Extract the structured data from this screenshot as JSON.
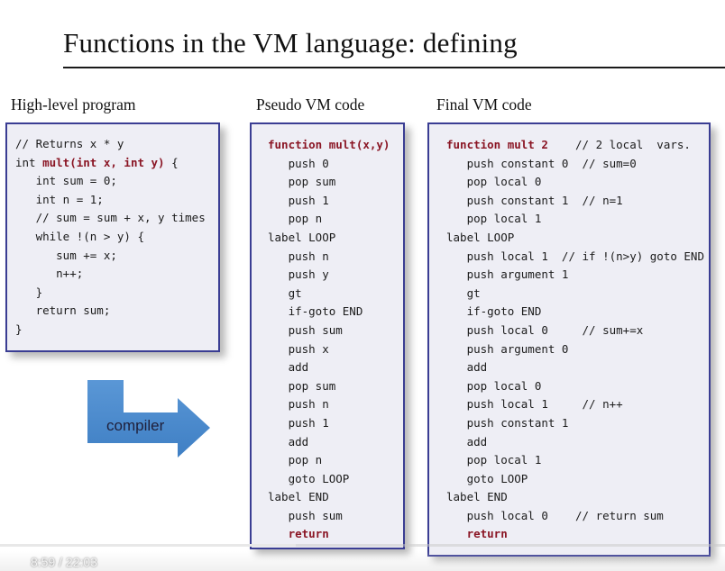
{
  "slide": {
    "title": "Functions in the VM language: defining",
    "columns": {
      "high_level": "High-level program",
      "pseudo": "Pseudo VM code",
      "final": "Final VM code"
    },
    "arrow_label": "compiler",
    "high_level_code": [
      [
        {
          "t": "// Returns x * y"
        }
      ],
      [
        {
          "t": "int "
        },
        {
          "t": "mult(int x, int y)",
          "k": true
        },
        {
          "t": " {"
        }
      ],
      [
        {
          "t": "   int sum = 0;"
        }
      ],
      [
        {
          "t": "   int n = 1;"
        }
      ],
      [
        {
          "t": "   // sum = sum + x, y times"
        }
      ],
      [
        {
          "t": "   while !(n > y) {"
        }
      ],
      [
        {
          "t": "      sum += x;"
        }
      ],
      [
        {
          "t": "      n++;"
        }
      ],
      [
        {
          "t": "   }"
        }
      ],
      [
        {
          "t": "   return sum;"
        }
      ],
      [
        {
          "t": "}"
        }
      ]
    ],
    "pseudo_code": [
      [
        {
          "t": "function mult(x,y)",
          "k": true
        }
      ],
      [
        {
          "t": "   push 0"
        }
      ],
      [
        {
          "t": "   pop sum"
        }
      ],
      [
        {
          "t": "   push 1"
        }
      ],
      [
        {
          "t": "   pop n"
        }
      ],
      [
        {
          "t": "label LOOP"
        }
      ],
      [
        {
          "t": "   push n"
        }
      ],
      [
        {
          "t": "   push y"
        }
      ],
      [
        {
          "t": "   gt"
        }
      ],
      [
        {
          "t": "   if-goto END"
        }
      ],
      [
        {
          "t": "   push sum"
        }
      ],
      [
        {
          "t": "   push x"
        }
      ],
      [
        {
          "t": "   add"
        }
      ],
      [
        {
          "t": "   pop sum"
        }
      ],
      [
        {
          "t": "   push n"
        }
      ],
      [
        {
          "t": "   push 1"
        }
      ],
      [
        {
          "t": "   add"
        }
      ],
      [
        {
          "t": "   pop n"
        }
      ],
      [
        {
          "t": "   goto LOOP"
        }
      ],
      [
        {
          "t": "label END"
        }
      ],
      [
        {
          "t": "   push sum"
        }
      ],
      [
        {
          "t": "   return",
          "k": true
        }
      ]
    ],
    "final_code": [
      [
        {
          "t": "function mult 2",
          "k": true
        },
        {
          "t": "    // 2 local  vars."
        }
      ],
      [
        {
          "t": "   push constant 0  // sum=0"
        }
      ],
      [
        {
          "t": "   pop local 0"
        }
      ],
      [
        {
          "t": "   push constant 1  // n=1"
        }
      ],
      [
        {
          "t": "   pop local 1"
        }
      ],
      [
        {
          "t": "label LOOP"
        }
      ],
      [
        {
          "t": "   push local 1  // if !(n>y) goto END"
        }
      ],
      [
        {
          "t": "   push argument 1"
        }
      ],
      [
        {
          "t": "   gt"
        }
      ],
      [
        {
          "t": "   if-goto END"
        }
      ],
      [
        {
          "t": "   push local 0     // sum+=x"
        }
      ],
      [
        {
          "t": "   push argument 0"
        }
      ],
      [
        {
          "t": "   add"
        }
      ],
      [
        {
          "t": "   pop local 0"
        }
      ],
      [
        {
          "t": "   push local 1     // n++"
        }
      ],
      [
        {
          "t": "   push constant 1"
        }
      ],
      [
        {
          "t": "   add"
        }
      ],
      [
        {
          "t": "   pop local 1"
        }
      ],
      [
        {
          "t": "   goto LOOP"
        }
      ],
      [
        {
          "t": "label END"
        }
      ],
      [
        {
          "t": "   push local 0    // return sum"
        }
      ],
      [
        {
          "t": "   return",
          "k": true
        }
      ]
    ]
  },
  "video": {
    "time_display": "8:59  /  22:03",
    "progress": 0.408
  },
  "colors": {
    "panel_border": "#3a3d93",
    "panel_bg": "#eeeef5",
    "keyword": "#8a1524",
    "arrow": "#4a86c8"
  },
  "icons": {
    "arrow": "bent-right-arrow-icon"
  }
}
